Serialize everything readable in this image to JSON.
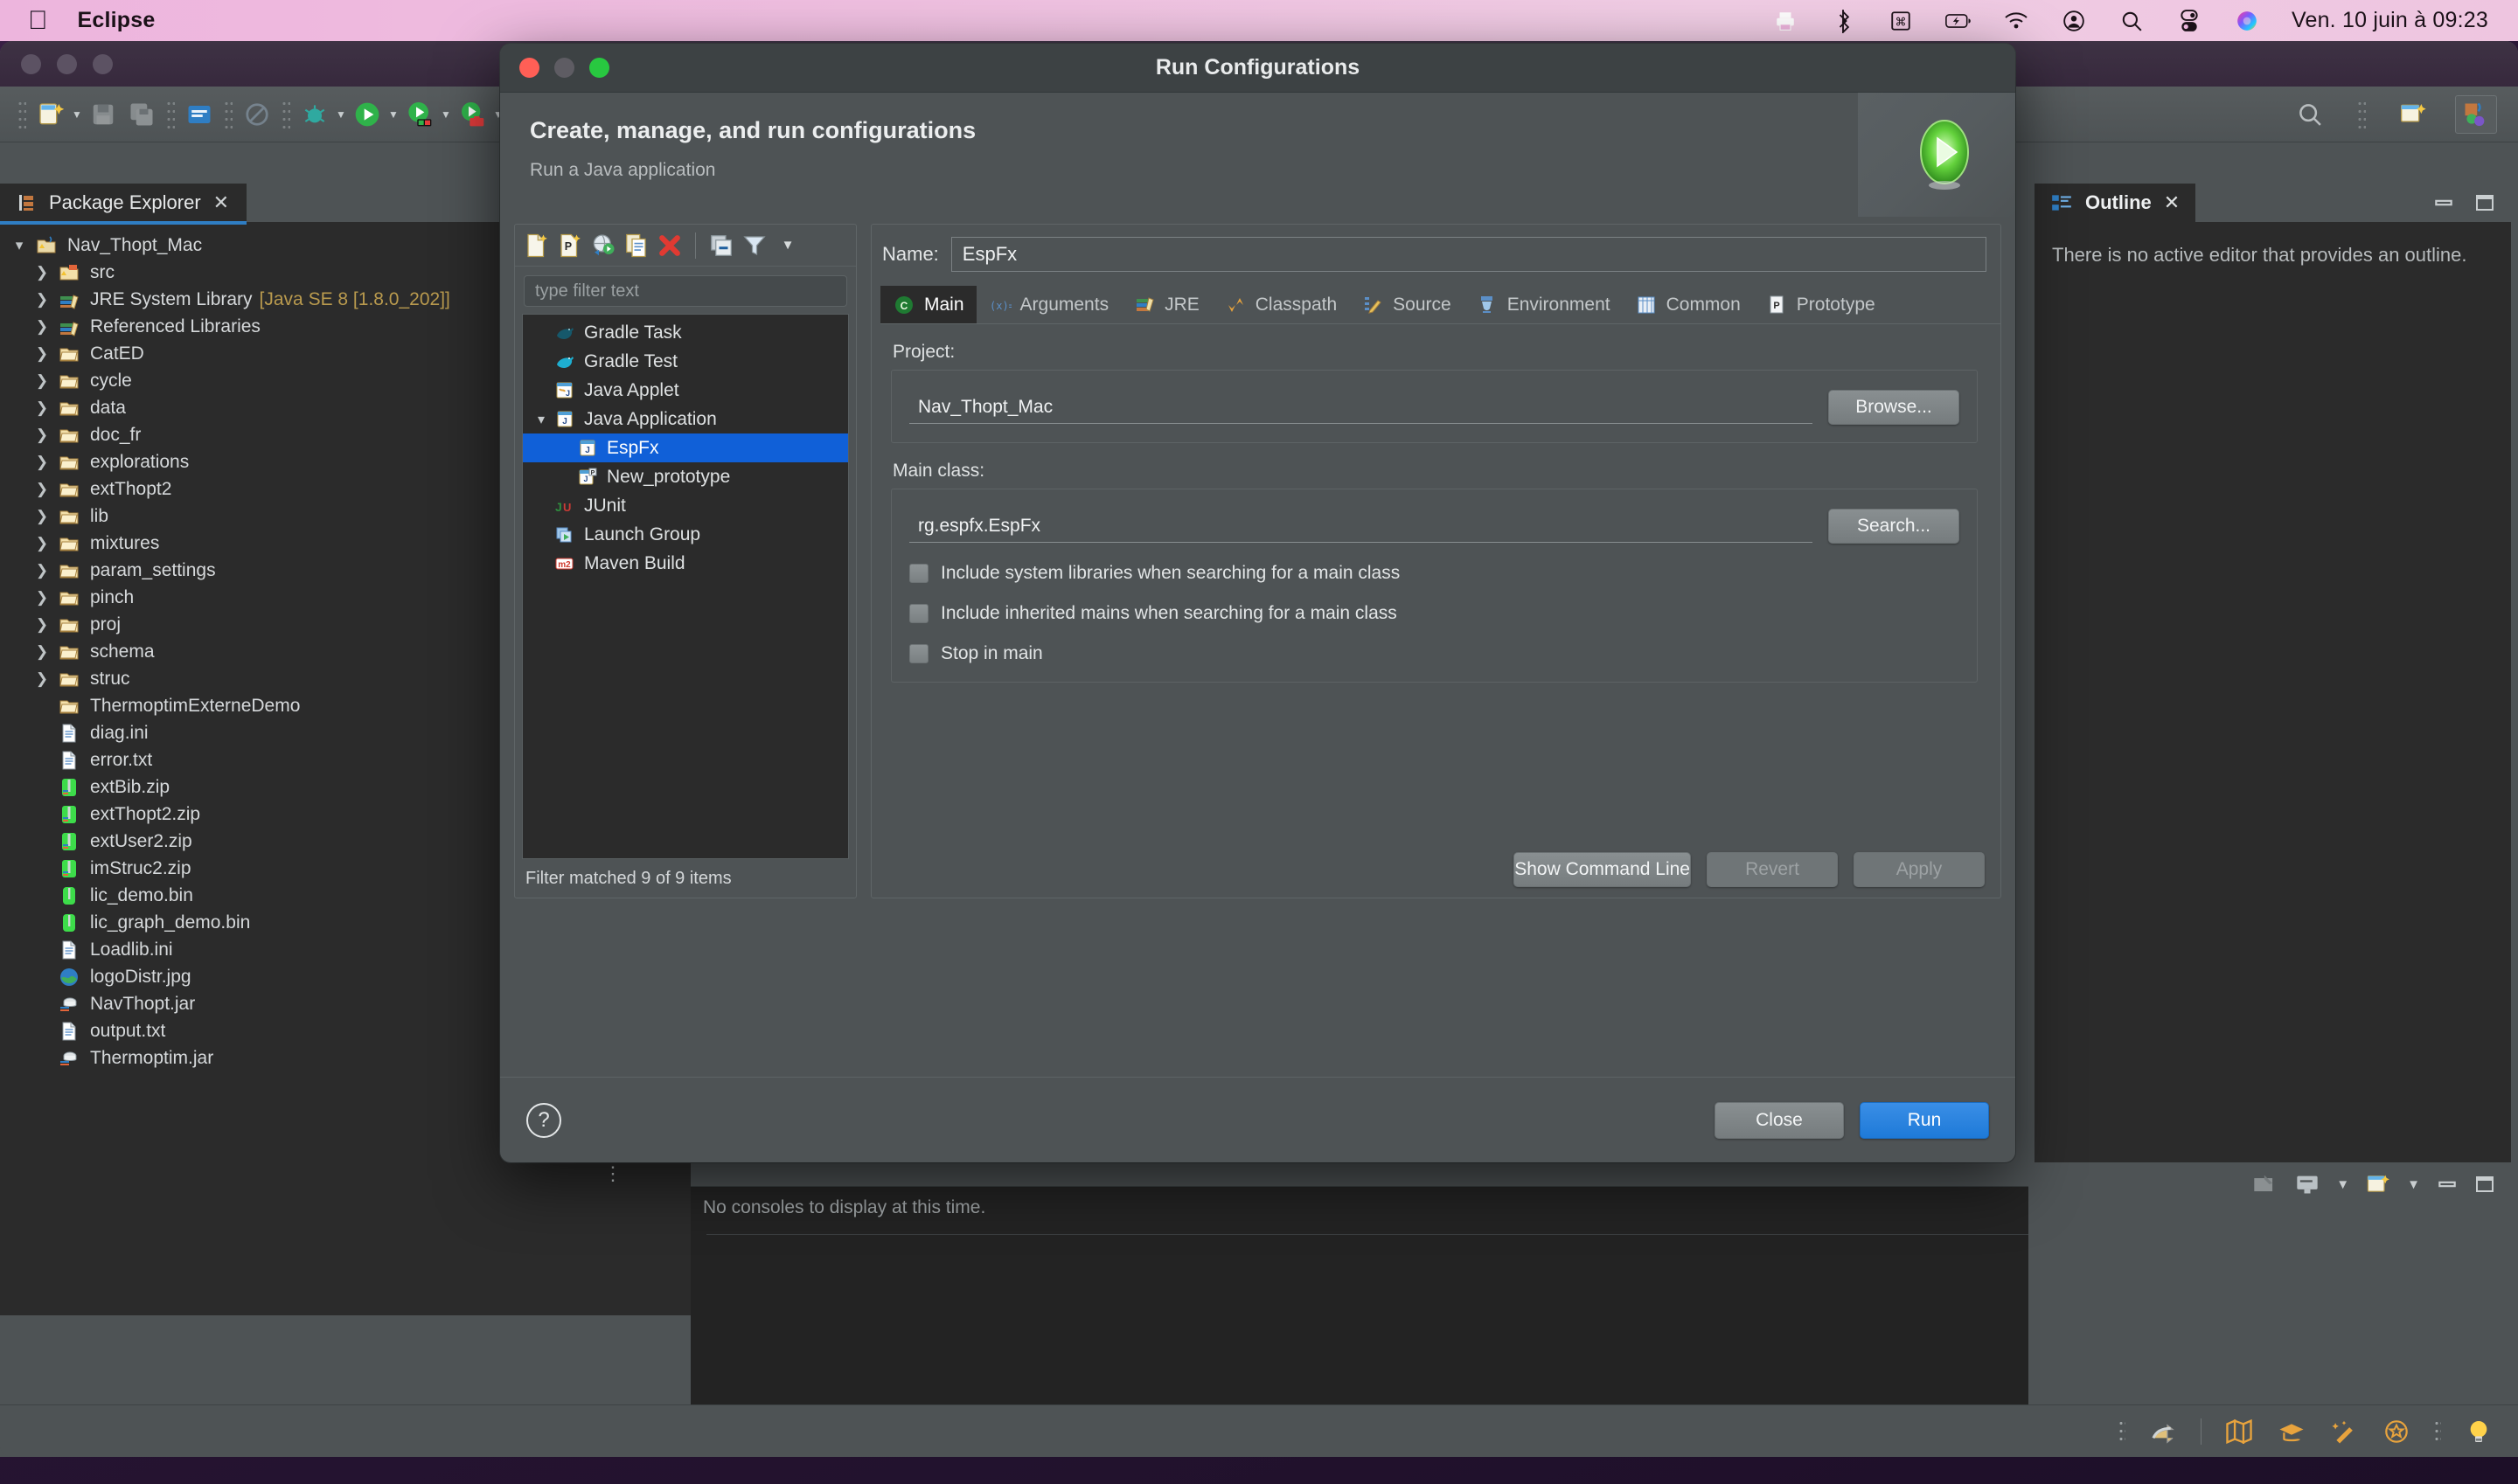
{
  "menubar": {
    "apple_icon": "apple-logo-icon",
    "app_name": "Eclipse",
    "status_icons": [
      "printer-icon",
      "bluetooth-icon",
      "keyboard-input-icon",
      "battery-charging-icon",
      "wifi-icon",
      "user-account-icon",
      "spotlight-search-icon",
      "control-center-icon",
      "siri-icon"
    ],
    "clock": "Ven. 10 juin à  09:23"
  },
  "toolbar": {
    "icons": [
      "new-wizard-icon",
      "save-icon",
      "save-all-icon",
      "print-icon",
      "no-entry-icon",
      "debug-icon",
      "run-icon",
      "run-external-icon",
      "run-toolbox-icon",
      "new-java-project-icon"
    ],
    "search_icon": "search-icon",
    "perspective_new_icon": "open-perspective-icon",
    "perspective_java_icon": "java-perspective-icon"
  },
  "package_explorer": {
    "tab_label": "Package Explorer",
    "close_icon": "close-icon",
    "tools": [
      "collapse-all-icon",
      "link-with-editor-icon"
    ],
    "tree": [
      {
        "arrow": "down",
        "icon": "java-project-icon",
        "label": "Nav_Thopt_Mac",
        "indent": 0,
        "sub": ""
      },
      {
        "arrow": "right",
        "icon": "source-folder-icon",
        "label": "src",
        "indent": 1,
        "sub": ""
      },
      {
        "arrow": "right",
        "icon": "library-icon",
        "label": "JRE System Library",
        "indent": 1,
        "sub": "[Java SE 8 [1.8.0_202]]"
      },
      {
        "arrow": "right",
        "icon": "library-icon",
        "label": "Referenced Libraries",
        "indent": 1,
        "sub": ""
      },
      {
        "arrow": "right",
        "icon": "folder-icon",
        "label": "CatED",
        "indent": 1,
        "sub": ""
      },
      {
        "arrow": "right",
        "icon": "folder-icon",
        "label": "cycle",
        "indent": 1,
        "sub": ""
      },
      {
        "arrow": "right",
        "icon": "folder-icon",
        "label": "data",
        "indent": 1,
        "sub": ""
      },
      {
        "arrow": "right",
        "icon": "folder-icon",
        "label": "doc_fr",
        "indent": 1,
        "sub": ""
      },
      {
        "arrow": "right",
        "icon": "folder-icon",
        "label": "explorations",
        "indent": 1,
        "sub": ""
      },
      {
        "arrow": "right",
        "icon": "folder-icon",
        "label": "extThopt2",
        "indent": 1,
        "sub": ""
      },
      {
        "arrow": "right",
        "icon": "folder-icon",
        "label": "lib",
        "indent": 1,
        "sub": ""
      },
      {
        "arrow": "right",
        "icon": "folder-icon",
        "label": "mixtures",
        "indent": 1,
        "sub": ""
      },
      {
        "arrow": "right",
        "icon": "folder-icon",
        "label": "param_settings",
        "indent": 1,
        "sub": ""
      },
      {
        "arrow": "right",
        "icon": "folder-icon",
        "label": "pinch",
        "indent": 1,
        "sub": ""
      },
      {
        "arrow": "right",
        "icon": "folder-icon",
        "label": "proj",
        "indent": 1,
        "sub": ""
      },
      {
        "arrow": "right",
        "icon": "folder-icon",
        "label": "schema",
        "indent": 1,
        "sub": ""
      },
      {
        "arrow": "right",
        "icon": "folder-icon",
        "label": "struc",
        "indent": 1,
        "sub": ""
      },
      {
        "arrow": "none",
        "icon": "folder-icon",
        "label": "ThermoptimExterneDemo",
        "indent": 1,
        "sub": ""
      },
      {
        "arrow": "none",
        "icon": "file-icon",
        "label": "diag.ini",
        "indent": 1,
        "sub": ""
      },
      {
        "arrow": "none",
        "icon": "file-icon",
        "label": "error.txt",
        "indent": 1,
        "sub": ""
      },
      {
        "arrow": "none",
        "icon": "zip-icon",
        "label": "extBib.zip",
        "indent": 1,
        "sub": ""
      },
      {
        "arrow": "none",
        "icon": "zip-icon",
        "label": "extThopt2.zip",
        "indent": 1,
        "sub": ""
      },
      {
        "arrow": "none",
        "icon": "zip-icon",
        "label": "extUser2.zip",
        "indent": 1,
        "sub": ""
      },
      {
        "arrow": "none",
        "icon": "zip-icon",
        "label": "imStruc2.zip",
        "indent": 1,
        "sub": ""
      },
      {
        "arrow": "none",
        "icon": "bin-icon",
        "label": "lic_demo.bin",
        "indent": 1,
        "sub": ""
      },
      {
        "arrow": "none",
        "icon": "bin-icon",
        "label": "lic_graph_demo.bin",
        "indent": 1,
        "sub": ""
      },
      {
        "arrow": "none",
        "icon": "file-icon",
        "label": "Loadlib.ini",
        "indent": 1,
        "sub": ""
      },
      {
        "arrow": "none",
        "icon": "image-icon",
        "label": "logoDistr.jpg",
        "indent": 1,
        "sub": ""
      },
      {
        "arrow": "none",
        "icon": "jar-icon",
        "label": "NavThopt.jar",
        "indent": 1,
        "sub": ""
      },
      {
        "arrow": "none",
        "icon": "file-icon",
        "label": "output.txt",
        "indent": 1,
        "sub": ""
      },
      {
        "arrow": "none",
        "icon": "jar-icon",
        "label": "Thermoptim.jar",
        "indent": 1,
        "sub": ""
      }
    ]
  },
  "outline": {
    "tab_label": "Outline",
    "close_icon": "close-icon",
    "message": "There is no active editor that provides an outline.",
    "window_icons": [
      "minimize-icon",
      "maximize-icon"
    ],
    "bottom_tools": [
      "pin-icon",
      "display-icon",
      "new-view-icon"
    ]
  },
  "console": {
    "message": "No consoles to display at this time."
  },
  "statusbar": {
    "icons": [
      "history-icon",
      "map-icon",
      "graduation-cap-icon",
      "magic-wand-icon",
      "star-badge-icon",
      "lightbulb-icon"
    ]
  },
  "dialog": {
    "title": "Run Configurations",
    "window_buttons": [
      "close-button",
      "minimize-button",
      "maximize-button"
    ],
    "heading": "Create, manage, and run configurations",
    "subheading": "Run a Java application",
    "banner_icon": "run-large-icon",
    "help_icon": "help-icon",
    "toolbar_icons": [
      "new-config-icon",
      "new-prototype-icon",
      "export-icon",
      "duplicate-icon",
      "delete-icon",
      "collapse-all-icon",
      "filter-icon",
      "filter-dropdown-icon"
    ],
    "filter_placeholder": "type filter text",
    "filter_value": "",
    "status": "Filter matched 9 of 9 items",
    "tree": [
      {
        "label": "Gradle Task",
        "icon": "gradle-icon",
        "indent": 1,
        "arrow": "none",
        "selected": false
      },
      {
        "label": "Gradle Test",
        "icon": "gradle-test-icon",
        "indent": 1,
        "arrow": "none",
        "selected": false
      },
      {
        "label": "Java Applet",
        "icon": "java-applet-icon",
        "indent": 1,
        "arrow": "none",
        "selected": false
      },
      {
        "label": "Java Application",
        "icon": "java-application-icon",
        "indent": 1,
        "arrow": "down",
        "selected": false
      },
      {
        "label": "EspFx",
        "icon": "java-config-icon",
        "indent": 2,
        "arrow": "none",
        "selected": true
      },
      {
        "label": "New_prototype",
        "icon": "java-prototype-icon",
        "indent": 2,
        "arrow": "none",
        "selected": false
      },
      {
        "label": "JUnit",
        "icon": "junit-icon",
        "indent": 1,
        "arrow": "none",
        "selected": false
      },
      {
        "label": "Launch Group",
        "icon": "launch-group-icon",
        "indent": 1,
        "arrow": "none",
        "selected": false
      },
      {
        "label": "Maven Build",
        "icon": "maven-icon",
        "indent": 1,
        "arrow": "none",
        "selected": false
      }
    ],
    "name_label": "Name:",
    "name_value": "EspFx",
    "tabs": [
      {
        "label": "Main",
        "icon": "main-class-icon",
        "active": true
      },
      {
        "label": "Arguments",
        "icon": "arguments-icon",
        "active": false
      },
      {
        "label": "JRE",
        "icon": "jre-icon",
        "active": false
      },
      {
        "label": "Classpath",
        "icon": "classpath-icon",
        "active": false
      },
      {
        "label": "Source",
        "icon": "source-icon",
        "active": false
      },
      {
        "label": "Environment",
        "icon": "environment-icon",
        "active": false
      },
      {
        "label": "Common",
        "icon": "common-icon",
        "active": false
      },
      {
        "label": "Prototype",
        "icon": "prototype-icon",
        "active": false
      }
    ],
    "project_label": "Project:",
    "project_value": "Nav_Thopt_Mac",
    "browse_label": "Browse...",
    "mainclass_label": "Main class:",
    "mainclass_value": "rg.espfx.EspFx",
    "search_label": "Search...",
    "checkboxes": [
      {
        "label": "Include system libraries when searching for a main class",
        "checked": false
      },
      {
        "label": "Include inherited mains when searching for a main class",
        "checked": false
      },
      {
        "label": "Stop in main",
        "checked": false
      }
    ],
    "show_command_line_label": "Show Command Line",
    "revert_label": "Revert",
    "apply_label": "Apply",
    "close_label": "Close",
    "run_label": "Run",
    "accent_color": "#1060d8",
    "primary_button_color": "#1e7ad8"
  }
}
